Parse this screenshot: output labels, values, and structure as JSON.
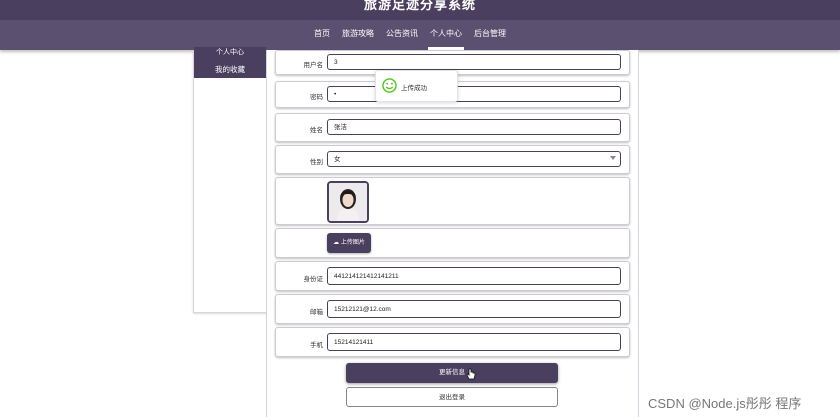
{
  "header": {
    "site_title": "旅游足迹分享系统"
  },
  "nav": {
    "items": [
      {
        "label": "首页"
      },
      {
        "label": "旅游攻略"
      },
      {
        "label": "公告资讯"
      },
      {
        "label": "个人中心"
      },
      {
        "label": "后台管理"
      }
    ],
    "active": "个人中心"
  },
  "sidebar": {
    "top_item": "个人中心",
    "fav_item": "我的收藏"
  },
  "form": {
    "username_label": "用户名",
    "username_value": "3",
    "password_label": "密码",
    "password_value": "•",
    "name_label": "姓名",
    "name_value": "张洁",
    "gender_label": "性别",
    "gender_value": "女",
    "upload_label": "上传图片",
    "idcard_label": "身份证",
    "idcard_value": "441214121412141211",
    "email_label": "邮箱",
    "email_value": "15212121@12.com",
    "phone_label": "手机",
    "phone_value": "15214121411"
  },
  "buttons": {
    "update": "更新信息",
    "logout": "退出登录"
  },
  "toast": {
    "message": "上传成功"
  },
  "watermark": "CSDN @Node.js彤彤 程序",
  "colors": {
    "primary": "#4a3f5f",
    "nav": "#5b5070",
    "success": "#52c41a"
  },
  "icons": [
    "smile-icon",
    "cloud-upload-icon",
    "chevron-down-icon",
    "hand-cursor-icon"
  ]
}
